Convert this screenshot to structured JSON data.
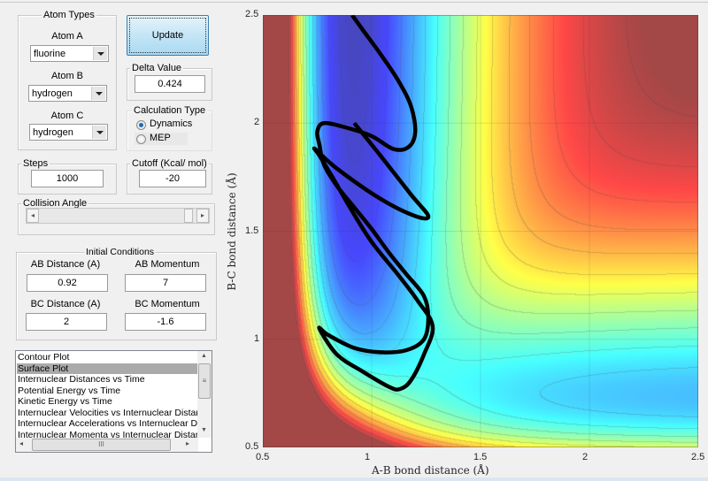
{
  "atom_types": {
    "title": "Atom Types",
    "atom_a": {
      "label": "Atom A",
      "value": "fluorine"
    },
    "atom_b": {
      "label": "Atom B",
      "value": "hydrogen"
    },
    "atom_c": {
      "label": "Atom C",
      "value": "hydrogen"
    }
  },
  "update_button": "Update",
  "delta": {
    "title": "Delta Value",
    "value": "0.424"
  },
  "calc_type": {
    "title": "Calculation Type",
    "options": [
      "Dynamics",
      "MEP"
    ],
    "selected": "Dynamics"
  },
  "steps": {
    "title": "Steps",
    "value": "1000"
  },
  "cutoff": {
    "title": "Cutoff (Kcal/ mol)",
    "value": "-20"
  },
  "collision_angle": {
    "title": "Collision Angle",
    "value_fraction": 1.0
  },
  "initial_conditions": {
    "title": "Initial Conditions",
    "ab_distance": {
      "label": "AB Distance (A)",
      "value": "0.92"
    },
    "ab_momentum": {
      "label": "AB Momentum",
      "value": "7"
    },
    "bc_distance": {
      "label": "BC Distance (A)",
      "value": "2"
    },
    "bc_momentum": {
      "label": "BC Momentum",
      "value": "-1.6"
    }
  },
  "plot_list": {
    "items": [
      "Contour Plot",
      "Surface Plot",
      "Internuclear Distances vs Time",
      "Potential Energy vs Time",
      "Kinetic Energy vs Time",
      "Internuclear Velocities vs Internuclear Distance",
      "Internuclear Accelerations vs Internuclear Distances",
      "Internuclear Momenta vs Internuclear Distance"
    ],
    "selected": "Surface Plot"
  },
  "chart_data": {
    "type": "heatmap",
    "description_type": "potential energy surface with contours and trajectory line",
    "xlabel": "A-B bond distance (Å)",
    "ylabel": "B-C bond distance (Å)",
    "xlim": [
      0.5,
      2.5
    ],
    "ylim": [
      0.5,
      2.5
    ],
    "xticks": [
      "0.5",
      "1",
      "1.5",
      "2",
      "2.5"
    ],
    "yticks": [
      "0.5",
      "1",
      "1.5",
      "2",
      "2.5"
    ],
    "grid": true,
    "colormap": "jet",
    "cutoff_color": "#a84c4c",
    "trajectory_color": "#000000",
    "trajectory": [
      [
        0.92,
        2.0
      ],
      [
        1.04,
        1.85
      ],
      [
        1.18,
        1.67
      ],
      [
        1.26,
        1.57
      ],
      [
        1.2,
        1.57
      ],
      [
        1.04,
        1.65
      ],
      [
        0.84,
        1.79
      ],
      [
        0.74,
        1.88
      ],
      [
        0.76,
        1.85
      ],
      [
        0.82,
        1.75
      ],
      [
        0.9,
        1.61
      ],
      [
        1.0,
        1.45
      ],
      [
        1.12,
        1.3
      ],
      [
        1.21,
        1.18
      ],
      [
        1.28,
        1.06
      ],
      [
        1.24,
        0.93
      ],
      [
        1.18,
        0.81
      ],
      [
        1.13,
        0.77
      ],
      [
        1.08,
        0.78
      ],
      [
        0.96,
        0.85
      ],
      [
        0.84,
        0.93
      ],
      [
        0.76,
        1.05
      ],
      [
        0.8,
        1.02
      ],
      [
        0.92,
        0.96
      ],
      [
        1.04,
        0.94
      ],
      [
        1.16,
        0.95
      ],
      [
        1.24,
        1.0
      ],
      [
        1.26,
        1.1
      ],
      [
        1.24,
        1.2
      ],
      [
        1.16,
        1.3
      ],
      [
        1.08,
        1.4
      ],
      [
        1.0,
        1.51
      ],
      [
        0.92,
        1.61
      ],
      [
        0.84,
        1.71
      ],
      [
        0.78,
        1.81
      ],
      [
        0.76,
        1.9
      ],
      [
        0.75,
        1.96
      ],
      [
        0.78,
        2.0
      ],
      [
        0.88,
        1.98
      ],
      [
        1.0,
        1.94
      ],
      [
        1.1,
        1.88
      ],
      [
        1.17,
        1.89
      ],
      [
        1.2,
        1.96
      ],
      [
        1.18,
        2.08
      ],
      [
        1.12,
        2.2
      ],
      [
        1.04,
        2.32
      ],
      [
        0.96,
        2.43
      ],
      [
        0.91,
        2.5
      ]
    ]
  }
}
